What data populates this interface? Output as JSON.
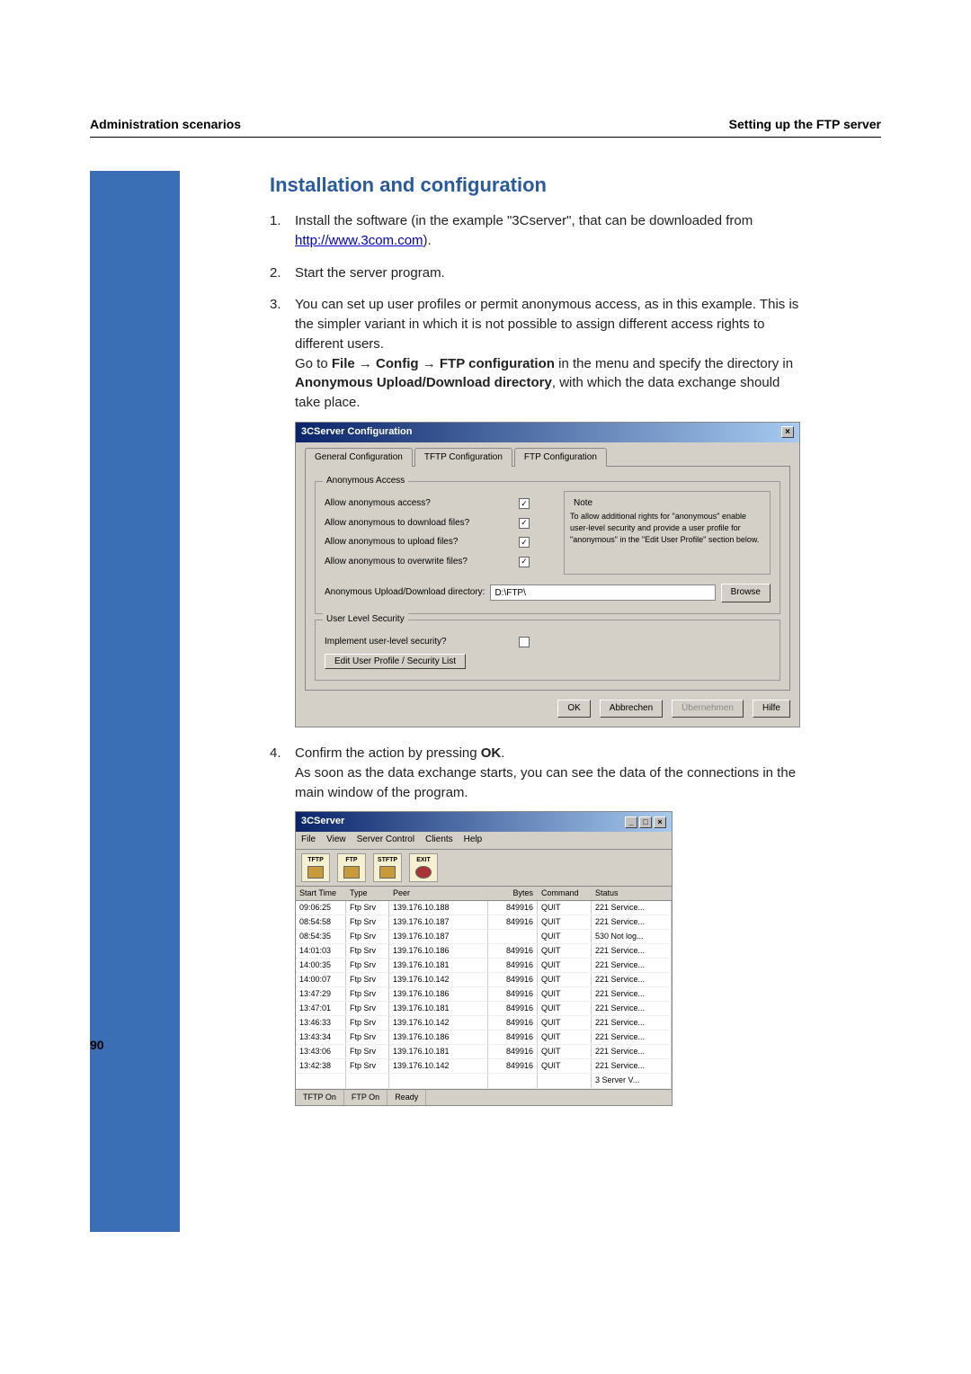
{
  "header": {
    "left": "Administration scenarios",
    "right": "Setting up the FTP server"
  },
  "section_title": "Installation and configuration",
  "page_number": "90",
  "steps": {
    "s1a": "Install the software (in the example \"3Cserver\", that can be downloaded from ",
    "s1_link": "http://www.3com.com",
    "s1b": ").",
    "s2": "Start the server program.",
    "s3a": "You can set up user profiles or permit anonymous access, as in this example. This is the simpler variant in which it is not possible to assign different access rights to different users.",
    "s3b_pre": "Go to ",
    "s3b_file": "File",
    "s3b_arrow1": " → ",
    "s3b_config": "Config",
    "s3b_arrow2": " → ",
    "s3b_ftp": "FTP configuration",
    "s3b_mid": " in the menu and specify the directory in ",
    "s3b_anon": "Anonymous Upload/Download directory",
    "s3b_post": ", with which the data exchange should take place.",
    "s4a": "Confirm the action by pressing ",
    "s4_ok": "OK",
    "s4b": ".",
    "s4c": "As soon as the data exchange starts, you can see the data of the connections in the main window of the program."
  },
  "dlg1": {
    "title": "3CServer Configuration",
    "tabs": [
      "General Configuration",
      "TFTP Configuration",
      "FTP Configuration"
    ],
    "group_anon": "Anonymous Access",
    "opt1": "Allow anonymous access?",
    "opt2": "Allow anonymous to download files?",
    "opt3": "Allow anonymous to upload files?",
    "opt4": "Allow anonymous to overwrite files?",
    "note_title": "Note",
    "note_body": "To allow additional rights for \"anonymous\" enable user-level security and provide a user profile for \"anonymous\" in the \"Edit User Profile\" section below.",
    "dir_label": "Anonymous Upload/Download directory:",
    "dir_value": "D:\\FTP\\",
    "browse": "Browse",
    "group_user": "User Level Security",
    "user_opt": "Implement user-level security?",
    "edit_btn": "Edit User Profile / Security List",
    "btn_ok": "OK",
    "btn_cancel": "Abbrechen",
    "btn_apply": "Übernehmen",
    "btn_help": "Hilfe"
  },
  "dlg2": {
    "title": "3CServer",
    "menus": [
      "File",
      "View",
      "Server Control",
      "Clients",
      "Help"
    ],
    "tool_tftp": "TFTP",
    "tool_ftp": "FTP",
    "tool_sftp": "STFTP",
    "tool_exit": "EXIT",
    "cols": [
      "Start Time",
      "Type",
      "Peer",
      "Bytes",
      "Command",
      "Status"
    ],
    "rows": [
      [
        "09:06:25",
        "Ftp Srv",
        "139.176.10.188",
        "849916",
        "QUIT",
        "221 Service..."
      ],
      [
        "08:54:58",
        "Ftp Srv",
        "139.176.10.187",
        "849916",
        "QUIT",
        "221 Service..."
      ],
      [
        "08:54:35",
        "Ftp Srv",
        "139.176.10.187",
        "",
        "QUIT",
        "530 Not log..."
      ],
      [
        "14:01:03",
        "Ftp Srv",
        "139.176.10.186",
        "849916",
        "QUIT",
        "221 Service..."
      ],
      [
        "14:00:35",
        "Ftp Srv",
        "139.176.10.181",
        "849916",
        "QUIT",
        "221 Service..."
      ],
      [
        "14:00:07",
        "Ftp Srv",
        "139.176.10.142",
        "849916",
        "QUIT",
        "221 Service..."
      ],
      [
        "13:47:29",
        "Ftp Srv",
        "139.176.10.186",
        "849916",
        "QUIT",
        "221 Service..."
      ],
      [
        "13:47:01",
        "Ftp Srv",
        "139.176.10.181",
        "849916",
        "QUIT",
        "221 Service..."
      ],
      [
        "13:46:33",
        "Ftp Srv",
        "139.176.10.142",
        "849916",
        "QUIT",
        "221 Service..."
      ],
      [
        "13:43:34",
        "Ftp Srv",
        "139.176.10.186",
        "849916",
        "QUIT",
        "221 Service..."
      ],
      [
        "13:43:06",
        "Ftp Srv",
        "139.176.10.181",
        "849916",
        "QUIT",
        "221 Service..."
      ],
      [
        "13:42:38",
        "Ftp Srv",
        "139.176.10.142",
        "849916",
        "QUIT",
        "221 Service..."
      ]
    ],
    "tail": "3 Server V...",
    "status": [
      "TFTP On",
      "FTP On",
      "Ready"
    ]
  }
}
